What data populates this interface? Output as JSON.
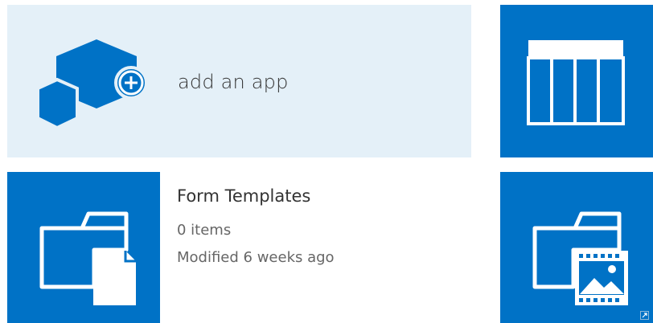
{
  "tiles": {
    "add_app": {
      "label": "add an app",
      "icon": "add-app-hexagon-icon"
    },
    "list_tile": {
      "icon": "list-table-icon"
    },
    "form_templates": {
      "title": "Form Templates",
      "items": "0 items",
      "modified": "Modified 6 weeks ago",
      "icon": "folder-document-icon"
    },
    "asset_library": {
      "icon": "folder-media-icon"
    }
  },
  "colors": {
    "tile_blue": "#0072c6",
    "add_app_background": "#e4f0f8",
    "text_dark": "#333333",
    "text_muted": "#666666"
  }
}
